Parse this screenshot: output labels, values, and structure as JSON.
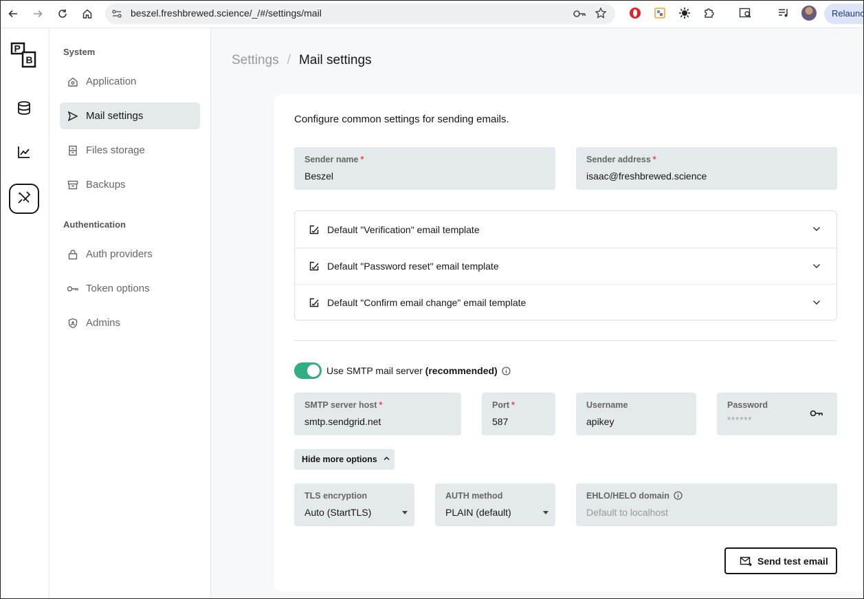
{
  "browser": {
    "url": "beszel.freshbrewed.science/_/#/settings/mail",
    "relaunch_label": "Relaunch"
  },
  "rail": {
    "logo_text_top": "P",
    "logo_text_bottom": "B",
    "items": [
      "database-icon",
      "chart-line-icon",
      "tools-icon"
    ],
    "active": "tools-icon"
  },
  "sidebar": {
    "group_system": "System",
    "system_items": [
      {
        "label": "Application",
        "icon": "home-icon"
      },
      {
        "label": "Mail settings",
        "icon": "send-icon"
      },
      {
        "label": "Files storage",
        "icon": "archive-drawer-icon"
      },
      {
        "label": "Backups",
        "icon": "archive-box-icon"
      }
    ],
    "group_auth": "Authentication",
    "auth_items": [
      {
        "label": "Auth providers",
        "icon": "lock-icon"
      },
      {
        "label": "Token options",
        "icon": "key-icon"
      },
      {
        "label": "Admins",
        "icon": "shield-user-icon"
      }
    ],
    "active": "Mail settings"
  },
  "breadcrumb": {
    "parent": "Settings",
    "separator": "/",
    "current": "Mail settings"
  },
  "form": {
    "intro": "Configure common settings for sending emails.",
    "sender_name": {
      "label": "Sender name",
      "required": "*",
      "value": "Beszel"
    },
    "sender_address": {
      "label": "Sender address",
      "required": "*",
      "value": "isaac@freshbrewed.science"
    },
    "templates": [
      "Default \"Verification\" email template",
      "Default \"Password reset\" email template",
      "Default \"Confirm email change\" email template"
    ],
    "smtp_toggle": {
      "label": "Use SMTP mail server",
      "bold": "(recommended)",
      "enabled": true
    },
    "smtp_host": {
      "label": "SMTP server host",
      "required": "*",
      "value": "smtp.sendgrid.net"
    },
    "port": {
      "label": "Port",
      "required": "*",
      "value": "587"
    },
    "username": {
      "label": "Username",
      "value": "apikey"
    },
    "password": {
      "label": "Password",
      "masked": "******"
    },
    "more_options_label": "Hide more options",
    "tls": {
      "label": "TLS encryption",
      "value": "Auto (StartTLS)"
    },
    "auth_method": {
      "label": "AUTH method",
      "value": "PLAIN (default)"
    },
    "ehlo": {
      "label": "EHLO/HELO domain",
      "placeholder": "Default to localhost"
    },
    "send_test_label": "Send test email"
  },
  "colors": {
    "accent_green": "#32ad84",
    "field_bg": "#e4e9ec",
    "required_red": "#e34562"
  }
}
